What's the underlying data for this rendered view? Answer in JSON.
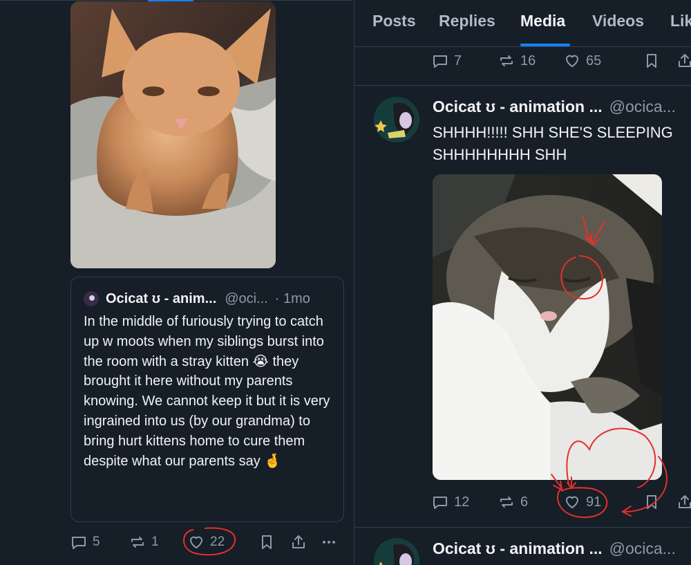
{
  "left_panel": {
    "quote": {
      "author_name": "Ocicat ʊ - anim...",
      "author_handle": "@oci...",
      "time": "· 1mo",
      "text": "In the middle of furiously trying to catch up w moots when my siblings burst into the room with a stray kitten 😭 they brought it here without my parents knowing. We cannot keep it but it is very ingrained into us (by our grandma) to bring hurt kittens home to cure them despite what our parents say 🤞"
    },
    "actions": {
      "replies": "5",
      "reposts": "1",
      "likes": "22"
    }
  },
  "right_panel": {
    "tabs": [
      "Posts",
      "Replies",
      "Media",
      "Videos",
      "Lik"
    ],
    "active_tab": "Media",
    "prev_post_actions": {
      "replies": "7",
      "reposts": "16",
      "likes": "65"
    },
    "post": {
      "author_name": "Ocicat ʊ - animation ...",
      "author_handle": "@ocica...",
      "text_line1": "SHHHH!!!!! SHH SHE'S SLEEPING",
      "text_line2": "SHHHHHHHH SHH",
      "actions": {
        "replies": "12",
        "reposts": "6",
        "likes": "91"
      }
    },
    "next_post": {
      "author_name": "Ocicat ʊ - animation ...",
      "author_handle": "@ocica..."
    }
  },
  "colors": {
    "background": "#161e27",
    "border": "#2e4052",
    "accent": "#1083fe",
    "muted_text": "#8c9bab",
    "annotation_red": "#e5302a"
  },
  "icons": [
    "reply-icon",
    "repost-icon",
    "heart-icon",
    "bookmark-icon",
    "share-icon",
    "more-icon"
  ]
}
